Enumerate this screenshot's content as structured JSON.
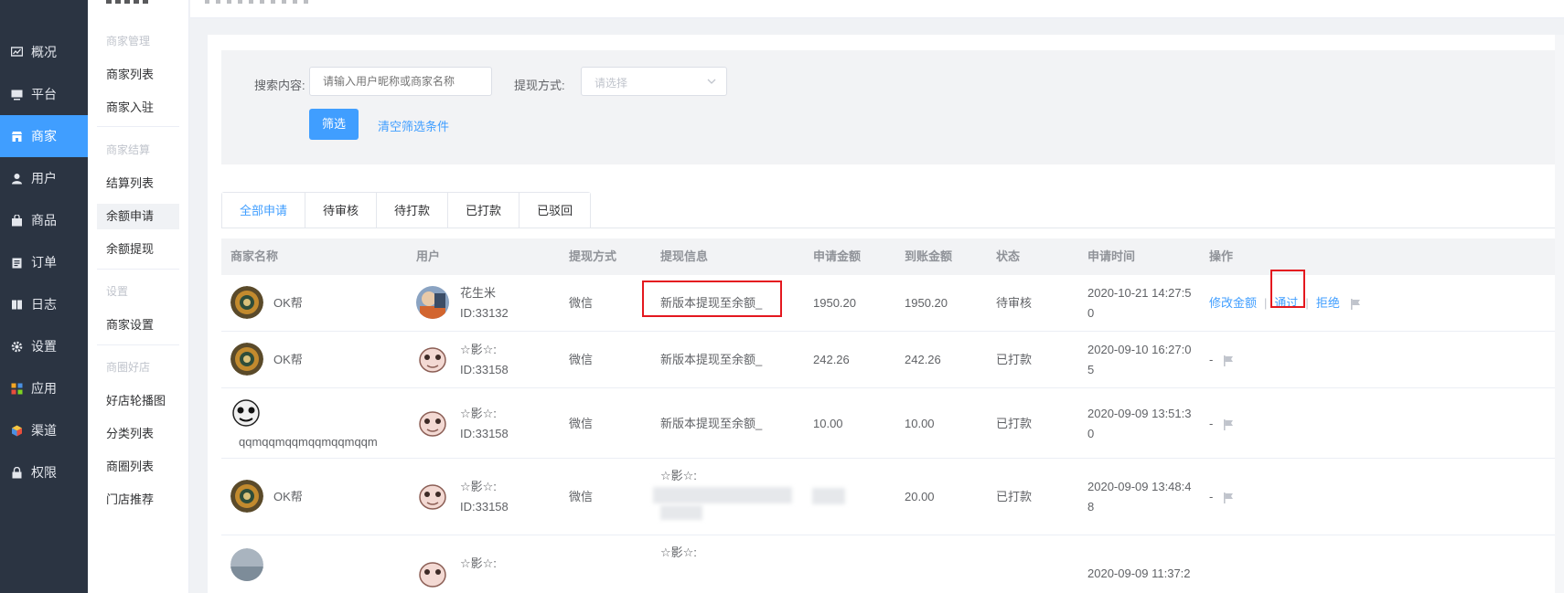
{
  "nav_primary": [
    {
      "label": "概况",
      "icon": "chart-icon"
    },
    {
      "label": "平台",
      "icon": "monitor-icon"
    },
    {
      "label": "商家",
      "icon": "store-icon",
      "active": true
    },
    {
      "label": "用户",
      "icon": "user-icon"
    },
    {
      "label": "商品",
      "icon": "bag-icon"
    },
    {
      "label": "订单",
      "icon": "clipboard-icon"
    },
    {
      "label": "日志",
      "icon": "book-icon"
    },
    {
      "label": "设置",
      "icon": "gear-icon"
    },
    {
      "label": "应用",
      "icon": "apps-icon"
    },
    {
      "label": "渠道",
      "icon": "cube-icon"
    },
    {
      "label": "权限",
      "icon": "lock-icon"
    }
  ],
  "nav_secondary": {
    "groups": [
      {
        "title": "商家管理",
        "items": [
          "商家列表",
          "商家入驻"
        ]
      },
      {
        "title": "商家结算",
        "items": [
          "结算列表",
          "余额申请",
          "余额提现"
        ]
      },
      {
        "title": "设置",
        "items": [
          "商家设置"
        ]
      },
      {
        "title": "商圈好店",
        "items": [
          "好店轮播图",
          "分类列表",
          "商圈列表",
          "门店推荐"
        ]
      }
    ],
    "active": "余额申请"
  },
  "filter": {
    "search_label": "搜索内容:",
    "search_placeholder": "请输入用户昵称或商家名称",
    "method_label": "提现方式:",
    "method_placeholder": "请选择",
    "submit_label": "筛选",
    "clear_label": "清空筛选条件"
  },
  "tabs": [
    {
      "label": "全部申请",
      "active": true
    },
    {
      "label": "待审核"
    },
    {
      "label": "待打款"
    },
    {
      "label": "已打款"
    },
    {
      "label": "已驳回"
    }
  ],
  "table": {
    "columns": [
      "商家名称",
      "用户",
      "提现方式",
      "提现信息",
      "申请金额",
      "到账金额",
      "状态",
      "申请时间",
      "操作"
    ],
    "rows": [
      {
        "merchant": "OK帮",
        "user_name": "花生米",
        "user_id": "ID:33132",
        "method": "微信",
        "info": "新版本提现至余额_",
        "apply_amount": "1950.20",
        "received_amount": "1950.20",
        "status": "待审核",
        "time_line1": "2020-10-21 14:27:5",
        "time_line2": "0",
        "ops": [
          "修改金额",
          "通过",
          "拒绝"
        ]
      },
      {
        "merchant": "OK帮",
        "user_name": "☆影☆:",
        "user_id": "ID:33158",
        "method": "微信",
        "info": "新版本提现至余额_",
        "apply_amount": "242.26",
        "received_amount": "242.26",
        "status": "已打款",
        "time_line1": "2020-09-10 16:27:0",
        "time_line2": "5",
        "ops_text": "-"
      },
      {
        "merchant": "qqmqqmqqmqqmqqmqqm",
        "user_name": "☆影☆:",
        "user_id": "ID:33158",
        "method": "微信",
        "info": "新版本提现至余额_",
        "apply_amount": "10.00",
        "received_amount": "10.00",
        "status": "已打款",
        "time_line1": "2020-09-09 13:51:3",
        "time_line2": "0",
        "ops_text": "-"
      },
      {
        "merchant": "OK帮",
        "user_name": "☆影☆:",
        "user_id": "ID:33158",
        "method": "微信",
        "info": "☆影☆:",
        "apply_amount": "",
        "received_amount": "20.00",
        "status": "已打款",
        "time_line1": "2020-09-09 13:48:4",
        "time_line2": "8",
        "ops_text": "-"
      },
      {
        "merchant": "",
        "user_name": "☆影☆:",
        "user_id": "",
        "method": "",
        "info": "☆影☆:",
        "apply_amount": "",
        "received_amount": "",
        "status": "",
        "time_line1": "2020-09-09 11:37:2",
        "time_line2": "",
        "ops_text": ""
      }
    ]
  },
  "colors": {
    "accent": "#409eff",
    "sidebar": "#2b3442",
    "highlight": "#e4181f"
  }
}
